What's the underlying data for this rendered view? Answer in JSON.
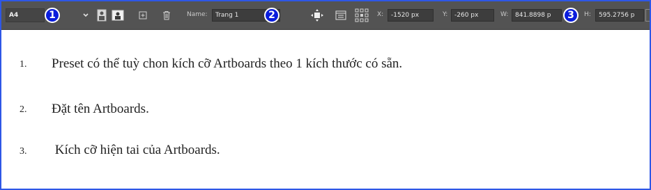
{
  "toolbar": {
    "preset_value": "A4",
    "badges": [
      "1",
      "2",
      "3"
    ],
    "name_label": "Name:",
    "name_value": "Trang 1",
    "x_label": "X:",
    "x_value": "-1520 px",
    "y_label": "Y:",
    "y_value": "-260 px",
    "w_label": "W:",
    "w_value": "841.8898 p",
    "h_label": "H:",
    "h_value": "595.2756 p",
    "icons": [
      "chevron-down-icon",
      "portrait-icon",
      "landscape-icon",
      "add-artboard-icon",
      "trash-icon",
      "move-artboard-icon",
      "artboard-options-icon",
      "reference-point-icon"
    ]
  },
  "items": [
    {
      "number": "1.",
      "text": "Preset có thể tuỳ chon kích cỡ Artboards theo 1 kích thước có sẵn."
    },
    {
      "number": "2.",
      "text": "Đặt tên Artboards."
    },
    {
      "number": "3.",
      "text": " Kích cỡ hiện tai của Artboards."
    }
  ],
  "colors": {
    "toolbar_bg": "#535353",
    "badge_bg": "#0a1ddc",
    "frame_border": "#2e57e6"
  }
}
